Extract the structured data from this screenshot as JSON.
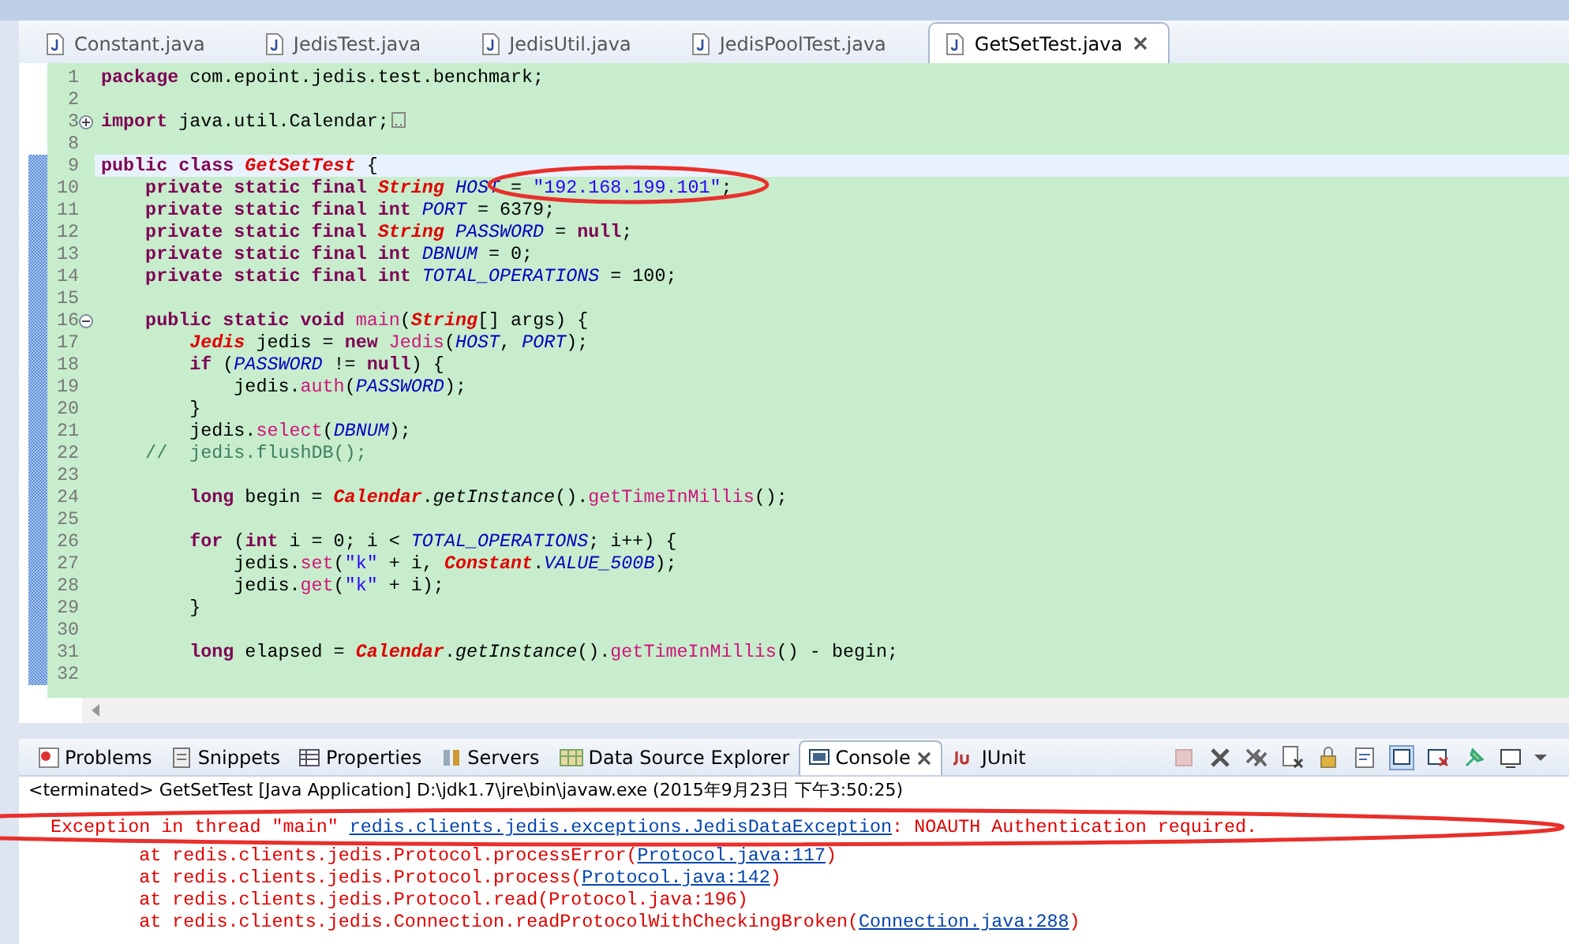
{
  "editor_tabs": [
    {
      "label": "Constant.java",
      "selected": false
    },
    {
      "label": "JedisTest.java",
      "selected": false
    },
    {
      "label": "JedisUtil.java",
      "selected": false
    },
    {
      "label": "JedisPoolTest.java",
      "selected": false
    },
    {
      "label": "GetSetTest.java",
      "selected": true
    }
  ],
  "editor": {
    "lines": [
      {
        "number": "1",
        "changed": false,
        "current": false,
        "tokens": [
          {
            "kind": "keyword",
            "text": "package"
          },
          {
            "kind": "plain",
            "text": " com.epoint.jedis.test.benchmark;"
          }
        ]
      },
      {
        "number": "2",
        "changed": false,
        "current": false
      },
      {
        "number": "3",
        "changed": false,
        "current": false,
        "collapsed": true,
        "tokens": [
          {
            "kind": "keyword",
            "text": "import"
          },
          {
            "kind": "plain",
            "text": " java.util.Calendar;"
          }
        ]
      },
      {
        "number": "8",
        "changed": false,
        "current": false
      },
      {
        "number": "9",
        "changed": true,
        "current": true,
        "tokens": [
          {
            "kind": "keyword",
            "text": "public class"
          },
          {
            "kind": "type",
            "text": " GetSetTest"
          },
          {
            "kind": "plain",
            "text": " {"
          }
        ]
      },
      {
        "number": "10",
        "changed": true,
        "current": false,
        "tokens": [
          {
            "kind": "keyword",
            "text": "    private static final"
          },
          {
            "kind": "type",
            "text": " String"
          },
          {
            "kind": "field",
            "text": " HOST"
          },
          {
            "kind": "plain",
            "text": " = "
          },
          {
            "kind": "string",
            "text": "\"192.168.199.101\""
          },
          {
            "kind": "plain",
            "text": ";"
          }
        ]
      },
      {
        "number": "11",
        "changed": true,
        "current": false,
        "tokens": [
          {
            "kind": "keyword",
            "text": "    private static final int"
          },
          {
            "kind": "field",
            "text": " PORT"
          },
          {
            "kind": "plain",
            "text": " = 6379;"
          }
        ]
      },
      {
        "number": "12",
        "changed": true,
        "current": false,
        "tokens": [
          {
            "kind": "keyword",
            "text": "    private static final"
          },
          {
            "kind": "type",
            "text": " String"
          },
          {
            "kind": "field",
            "text": " PASSWORD"
          },
          {
            "kind": "plain",
            "text": " = "
          },
          {
            "kind": "keyword",
            "text": "null"
          },
          {
            "kind": "plain",
            "text": ";"
          }
        ]
      },
      {
        "number": "13",
        "changed": true,
        "current": false,
        "tokens": [
          {
            "kind": "keyword",
            "text": "    private static final int"
          },
          {
            "kind": "field",
            "text": " DBNUM"
          },
          {
            "kind": "plain",
            "text": " = 0;"
          }
        ]
      },
      {
        "number": "14",
        "changed": true,
        "current": false,
        "tokens": [
          {
            "kind": "keyword",
            "text": "    private static final int"
          },
          {
            "kind": "field",
            "text": " TOTAL_OPERATIONS"
          },
          {
            "kind": "plain",
            "text": " = 100;"
          }
        ]
      },
      {
        "number": "15",
        "changed": true,
        "current": false
      },
      {
        "number": "16",
        "changed": true,
        "current": false,
        "collapsed": false,
        "tokens": [
          {
            "kind": "keyword",
            "text": "    public static void"
          },
          {
            "kind": "method",
            "text": " main"
          },
          {
            "kind": "plain",
            "text": "("
          },
          {
            "kind": "type",
            "text": "String"
          },
          {
            "kind": "plain",
            "text": "[] args) {"
          }
        ]
      },
      {
        "number": "17",
        "changed": true,
        "current": false,
        "tokens": [
          {
            "kind": "type",
            "text": "        Jedis"
          },
          {
            "kind": "plain",
            "text": " jedis = "
          },
          {
            "kind": "keyword",
            "text": "new"
          },
          {
            "kind": "method",
            "text": " Jedis"
          },
          {
            "kind": "plain",
            "text": "("
          },
          {
            "kind": "field",
            "text": "HOST"
          },
          {
            "kind": "plain",
            "text": ", "
          },
          {
            "kind": "field",
            "text": "PORT"
          },
          {
            "kind": "plain",
            "text": ");"
          }
        ]
      },
      {
        "number": "18",
        "changed": true,
        "current": false,
        "tokens": [
          {
            "kind": "keyword",
            "text": "        if"
          },
          {
            "kind": "plain",
            "text": " ("
          },
          {
            "kind": "field",
            "text": "PASSWORD"
          },
          {
            "kind": "plain",
            "text": " != "
          },
          {
            "kind": "keyword",
            "text": "null"
          },
          {
            "kind": "plain",
            "text": ") {"
          }
        ]
      },
      {
        "number": "19",
        "changed": true,
        "current": false,
        "tokens": [
          {
            "kind": "plain",
            "text": "            jedis."
          },
          {
            "kind": "method",
            "text": "auth"
          },
          {
            "kind": "plain",
            "text": "("
          },
          {
            "kind": "field",
            "text": "PASSWORD"
          },
          {
            "kind": "plain",
            "text": ");"
          }
        ]
      },
      {
        "number": "20",
        "changed": true,
        "current": false,
        "tokens": [
          {
            "kind": "plain",
            "text": "        }"
          }
        ]
      },
      {
        "number": "21",
        "changed": true,
        "current": false,
        "tokens": [
          {
            "kind": "plain",
            "text": "        jedis."
          },
          {
            "kind": "method",
            "text": "select"
          },
          {
            "kind": "plain",
            "text": "("
          },
          {
            "kind": "field",
            "text": "DBNUM"
          },
          {
            "kind": "plain",
            "text": ");"
          }
        ]
      },
      {
        "number": "22",
        "changed": true,
        "current": false,
        "tokens": [
          {
            "kind": "comment",
            "text": "    //  jedis.flushDB();"
          }
        ]
      },
      {
        "number": "23",
        "changed": true,
        "current": false
      },
      {
        "number": "24",
        "changed": true,
        "current": false,
        "tokens": [
          {
            "kind": "keyword",
            "text": "        long"
          },
          {
            "kind": "plain",
            "text": " begin = "
          },
          {
            "kind": "type",
            "text": "Calendar"
          },
          {
            "kind": "plain",
            "text": "."
          },
          {
            "kind": "static",
            "text": "getInstance"
          },
          {
            "kind": "plain",
            "text": "()."
          },
          {
            "kind": "method",
            "text": "getTimeInMillis"
          },
          {
            "kind": "plain",
            "text": "();"
          }
        ]
      },
      {
        "number": "25",
        "changed": true,
        "current": false
      },
      {
        "number": "26",
        "changed": true,
        "current": false,
        "tokens": [
          {
            "kind": "keyword",
            "text": "        for"
          },
          {
            "kind": "plain",
            "text": " ("
          },
          {
            "kind": "keyword",
            "text": "int"
          },
          {
            "kind": "plain",
            "text": " i = 0; i < "
          },
          {
            "kind": "field",
            "text": "TOTAL_OPERATIONS"
          },
          {
            "kind": "plain",
            "text": "; i++) {"
          }
        ]
      },
      {
        "number": "27",
        "changed": true,
        "current": false,
        "tokens": [
          {
            "kind": "plain",
            "text": "            jedis."
          },
          {
            "kind": "method",
            "text": "set"
          },
          {
            "kind": "plain",
            "text": "("
          },
          {
            "kind": "string",
            "text": "\"k\""
          },
          {
            "kind": "plain",
            "text": " + i, "
          },
          {
            "kind": "type",
            "text": "Constant"
          },
          {
            "kind": "plain",
            "text": "."
          },
          {
            "kind": "field",
            "text": "VALUE_500B"
          },
          {
            "kind": "plain",
            "text": ");"
          }
        ]
      },
      {
        "number": "28",
        "changed": true,
        "current": false,
        "tokens": [
          {
            "kind": "plain",
            "text": "            jedis."
          },
          {
            "kind": "method",
            "text": "get"
          },
          {
            "kind": "plain",
            "text": "("
          },
          {
            "kind": "string",
            "text": "\"k\""
          },
          {
            "kind": "plain",
            "text": " + i);"
          }
        ]
      },
      {
        "number": "29",
        "changed": true,
        "current": false,
        "tokens": [
          {
            "kind": "plain",
            "text": "        }"
          }
        ]
      },
      {
        "number": "30",
        "changed": true,
        "current": false
      },
      {
        "number": "31",
        "changed": true,
        "current": false,
        "tokens": [
          {
            "kind": "keyword",
            "text": "        long"
          },
          {
            "kind": "plain",
            "text": " elapsed = "
          },
          {
            "kind": "type",
            "text": "Calendar"
          },
          {
            "kind": "plain",
            "text": "."
          },
          {
            "kind": "static",
            "text": "getInstance"
          },
          {
            "kind": "plain",
            "text": "()."
          },
          {
            "kind": "method",
            "text": "getTimeInMillis"
          },
          {
            "kind": "plain",
            "text": "() - begin;"
          }
        ]
      },
      {
        "number": "32",
        "changed": true,
        "current": false
      }
    ]
  },
  "panel_tabs": [
    {
      "label": "Problems",
      "selected": false
    },
    {
      "label": "Snippets",
      "selected": false
    },
    {
      "label": "Properties",
      "selected": false
    },
    {
      "label": "Servers",
      "selected": false
    },
    {
      "label": "Data Source Explorer",
      "selected": false
    },
    {
      "label": "Console",
      "selected": true
    },
    {
      "label": "JUnit",
      "selected": false
    }
  ],
  "console": {
    "header": "<terminated> GetSetTest [Java Application] D:\\jdk1.7\\jre\\bin\\javaw.exe (2015年9月23日 下午3:50:25)",
    "lines": [
      [
        {
          "kind": "error",
          "text": "Exception in thread \"main\" "
        },
        {
          "kind": "link",
          "text": "redis.clients.jedis.exceptions.JedisDataException"
        },
        {
          "kind": "error",
          "text": ": NOAUTH Authentication required."
        }
      ],
      [
        {
          "kind": "error",
          "text": "\tat redis.clients.jedis.Protocol.processError("
        },
        {
          "kind": "link",
          "text": "Protocol.java:117"
        },
        {
          "kind": "error",
          "text": ")"
        }
      ],
      [
        {
          "kind": "error",
          "text": "\tat redis.clients.jedis.Protocol.process("
        },
        {
          "kind": "link",
          "text": "Protocol.java:142"
        },
        {
          "kind": "error",
          "text": ")"
        }
      ],
      [
        {
          "kind": "error",
          "text": "\tat redis.clients.jedis.Protocol.read(Protocol.java:196)"
        }
      ],
      [
        {
          "kind": "error",
          "text": "\tat redis.clients.jedis.Connection.readProtocolWithCheckingBroken("
        },
        {
          "kind": "link",
          "text": "Connection.java:288"
        },
        {
          "kind": "error",
          "text": ")"
        }
      ]
    ]
  }
}
